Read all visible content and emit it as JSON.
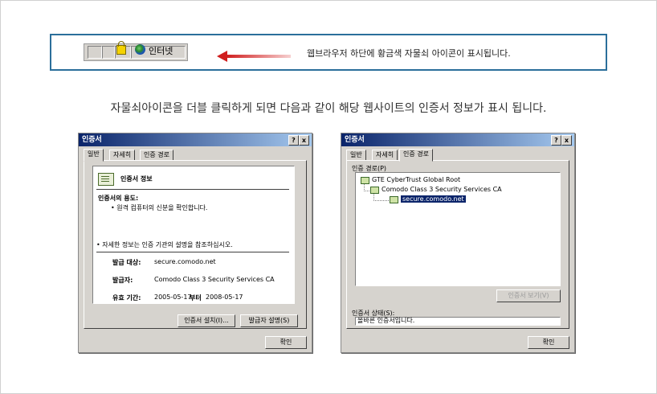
{
  "banner": {
    "status_text": "인터넷",
    "description": "웹브라우저 하단에 황금색 자물쇠 아이콘이 표시됩니다."
  },
  "caption": "자물쇠아이콘을 더블 클릭하게 되면 다음과 같이 해당 웹사이트의 인증서 정보가 표시 됩니다.",
  "left_dialog": {
    "title": "인증서",
    "help_btn": "?",
    "close_btn": "x",
    "tabs": [
      "일반",
      "자세히",
      "인증 경로"
    ],
    "heading": "인증서 정보",
    "purpose_label": "인증서의 용도:",
    "purpose_item": "• 원격 컴퓨터의 신분을 확인합니다.",
    "note": "• 자세한 정보는 인증 기관의 설명을 참조하십시오.",
    "issued_to_label": "발급 대상:",
    "issued_to_value": "secure.comodo.net",
    "issuer_label": "발급자:",
    "issuer_value": "Comodo Class 3 Security Services CA",
    "valid_label": "유효 기간:",
    "valid_from": "2005-05-17",
    "valid_to_label": "부터",
    "valid_to": "2008-05-17",
    "install_btn": "인증서 설치(I)...",
    "issuer_stmt_btn": "발급자 설명(S)",
    "ok_btn": "확인"
  },
  "right_dialog": {
    "title": "인증서",
    "help_btn": "?",
    "close_btn": "x",
    "tabs": [
      "일반",
      "자세히",
      "인증 경로"
    ],
    "path_label": "인증 경로(P)",
    "path": [
      "GTE CyberTrust Global Root",
      "Comodo Class 3 Security Services CA",
      "secure.comodo.net"
    ],
    "view_btn": "인증서 보기(V)",
    "status_label": "인증서 상태(S):",
    "status_value": "올바른 인증서입니다.",
    "ok_btn": "확인"
  }
}
